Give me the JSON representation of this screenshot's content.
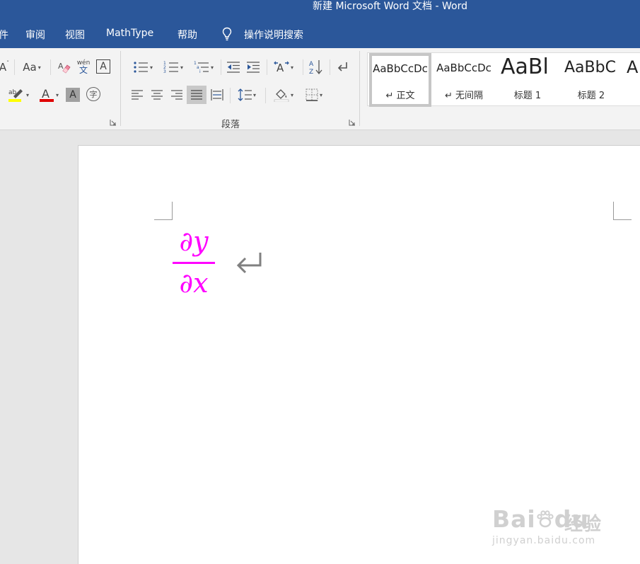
{
  "window": {
    "title": "新建 Microsoft Word 文档  -  Word"
  },
  "menu": {
    "items": [
      {
        "label": "件"
      },
      {
        "label": "审阅"
      },
      {
        "label": "视图"
      },
      {
        "label": "MathType"
      },
      {
        "label": "帮助"
      }
    ],
    "tell_me": "操作说明搜索"
  },
  "ribbon": {
    "font_group": {
      "change_case_label": "Aa",
      "phonetic_label": "wén",
      "phonetic_sub": "文",
      "char_border_label": "A",
      "highlight_label": "ab",
      "font_color_label": "A",
      "shading_label": "A",
      "enclose_label": "字",
      "highlight_color": "#ffff00",
      "font_color": "#e00000"
    },
    "paragraph_group": {
      "label": "段落"
    },
    "styles": [
      {
        "sample": "AaBbCcDc",
        "name": "↵ 正文",
        "selected": true
      },
      {
        "sample": "AaBbCcDc",
        "name": "↵ 无间隔",
        "selected": false
      },
      {
        "sample": "AaBl",
        "name": "标题 1",
        "selected": false
      },
      {
        "sample": "AaBbC",
        "name": "标题 2",
        "selected": false
      },
      {
        "sample": "A",
        "name": "",
        "selected": false
      }
    ]
  },
  "document": {
    "equation": {
      "numerator": "∂y",
      "denominator": "∂x",
      "color": "#ff00ff"
    }
  },
  "watermark": {
    "logo": "Bai",
    "logo_du": "du",
    "jingyan": "经验",
    "url": "jingyan.baidu.com"
  }
}
